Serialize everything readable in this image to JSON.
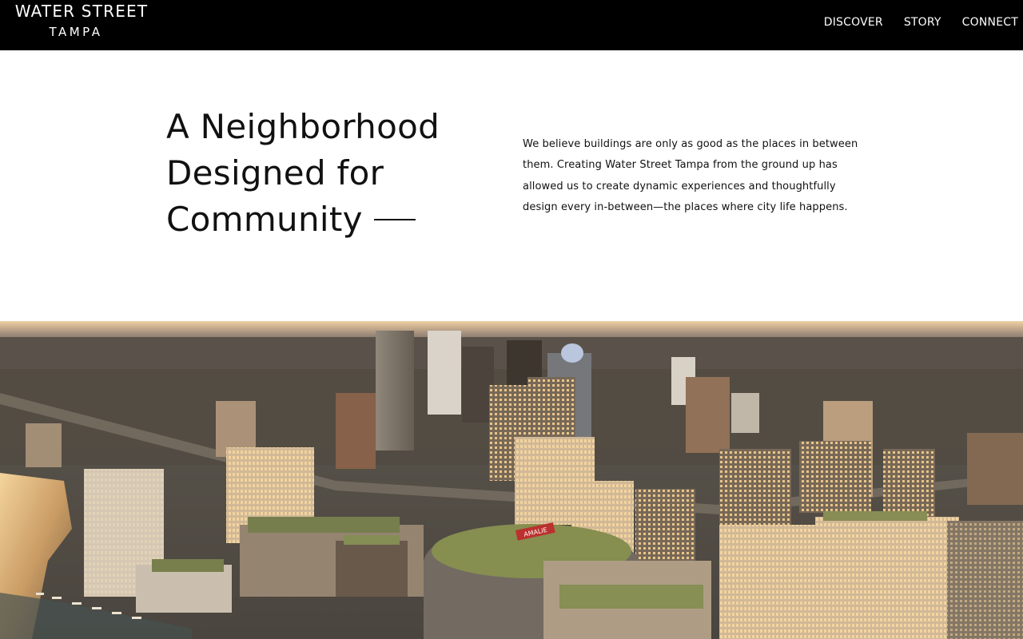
{
  "header": {
    "logo": {
      "line1": "WATER STREET",
      "line2": "TAMPA"
    },
    "nav": [
      {
        "label": "DISCOVER"
      },
      {
        "label": "STORY"
      },
      {
        "label": "CONNECT"
      }
    ]
  },
  "intro": {
    "headline": [
      "A Neighborhood",
      "Designed for",
      "Community"
    ],
    "paragraph_lines": [
      "We believe buildings are only as good as the places in between",
      "them. Creating Water Street Tampa from the ground up has",
      "allowed us to create dynamic experiences and thoughtfully",
      "design every in-between—the places where city life happens."
    ]
  },
  "hero": {
    "arena_sign": "AMALIE"
  },
  "colors": {
    "header_bg": "#000000",
    "page_bg": "#ffffff",
    "text": "#111111"
  }
}
